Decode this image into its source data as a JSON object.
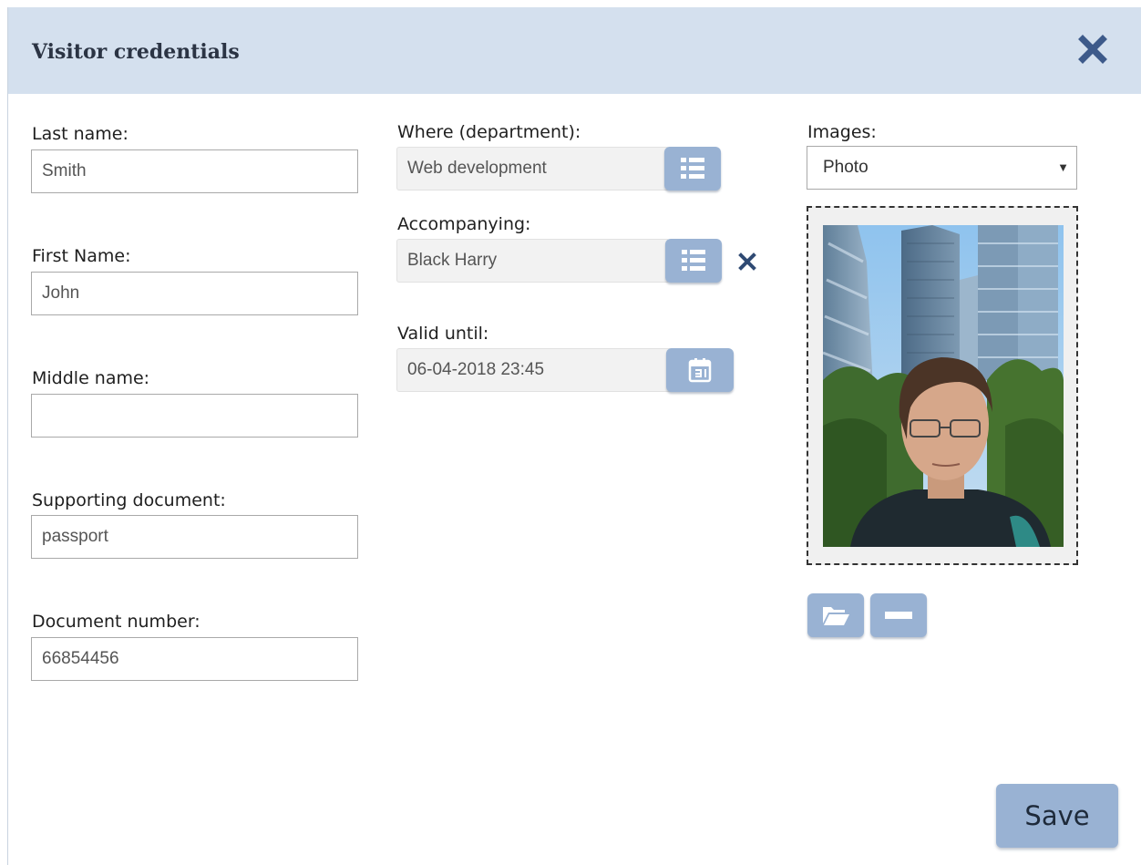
{
  "dialog": {
    "title": "Visitor credentials",
    "close_icon": "close-icon"
  },
  "left_column": {
    "last_name": {
      "label": "Last name:",
      "value": "Smith"
    },
    "first_name": {
      "label": "First Name:",
      "value": "John"
    },
    "middle_name": {
      "label": "Middle name:",
      "value": ""
    },
    "supporting_document": {
      "label": "Supporting document:",
      "value": "passport"
    },
    "document_number": {
      "label": "Document number:",
      "value": "66854456"
    }
  },
  "middle_column": {
    "department": {
      "label": "Where (department):",
      "value": "Web development",
      "button_icon": "list-icon"
    },
    "accompanying": {
      "label": "Accompanying:",
      "value": "Black Harry",
      "button_icon": "list-icon",
      "clear_icon": "close-icon"
    },
    "valid_until": {
      "label": "Valid until:",
      "value": "06-04-2018 23:45",
      "button_icon": "calendar-icon"
    }
  },
  "right_column": {
    "images": {
      "label": "Images:",
      "selected": "Photo"
    },
    "photo_alt": "",
    "open_button_icon": "folder-open-icon",
    "remove_button_icon": "minus-icon"
  },
  "footer": {
    "save_label": "Save"
  },
  "colors": {
    "header_bg": "#d4e0ee",
    "button_bg": "#99b2d3",
    "close_icon": "#3d5a8a"
  }
}
